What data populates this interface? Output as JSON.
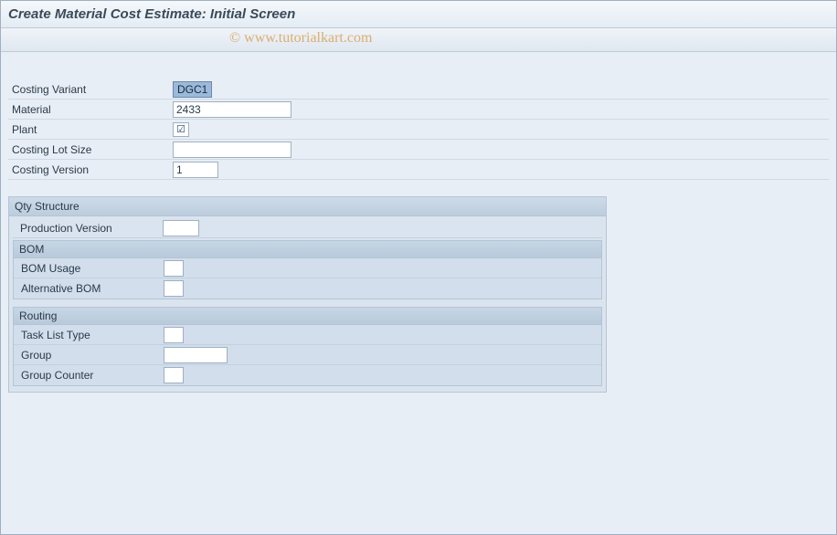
{
  "title": "Create Material Cost Estimate: Initial Screen",
  "watermark": "© www.tutorialkart.com",
  "fields": {
    "costing_variant": {
      "label": "Costing Variant",
      "value": "DGC1"
    },
    "material": {
      "label": "Material",
      "value": "2433"
    },
    "plant": {
      "label": "Plant",
      "checked": "☑"
    },
    "costing_lot_size": {
      "label": "Costing Lot Size",
      "value": ""
    },
    "costing_version": {
      "label": "Costing Version",
      "value": "1"
    }
  },
  "qty_structure": {
    "title": "Qty Structure",
    "production_version": {
      "label": "Production Version",
      "value": ""
    },
    "bom": {
      "title": "BOM",
      "usage": {
        "label": "BOM Usage",
        "value": ""
      },
      "alternative": {
        "label": "Alternative BOM",
        "value": ""
      }
    },
    "routing": {
      "title": "Routing",
      "task_list_type": {
        "label": "Task List Type",
        "value": ""
      },
      "group": {
        "label": "Group",
        "value": ""
      },
      "group_counter": {
        "label": "Group Counter",
        "value": ""
      }
    }
  }
}
